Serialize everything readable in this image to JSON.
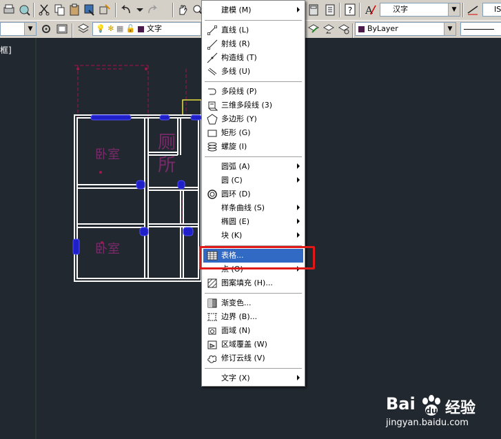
{
  "toolbar_top": {
    "text_style_value": "汉字",
    "style_partial": "IS"
  },
  "toolbar_layer": {
    "layer_name": "文字",
    "color_value": "ByLayer"
  },
  "viewport": {
    "label": "框]"
  },
  "drawing": {
    "rooms": [
      "卧室",
      "厕所",
      "卧室"
    ]
  },
  "context_menu": {
    "header": {
      "label": "建模 (M)",
      "submenu": true
    },
    "groups": [
      [
        {
          "label": "直线 (L)",
          "icon": "line-icon"
        },
        {
          "label": "射线 (R)",
          "icon": "ray-icon"
        },
        {
          "label": "构造线 (T)",
          "icon": "xline-icon"
        },
        {
          "label": "多线 (U)",
          "icon": "multiline-icon"
        }
      ],
      [
        {
          "label": "多段线 (P)",
          "icon": "polyline-icon"
        },
        {
          "label": "三维多段线 (3)",
          "icon": "3d-polyline-icon"
        },
        {
          "label": "多边形 (Y)",
          "icon": "polygon-icon"
        },
        {
          "label": "矩形 (G)",
          "icon": "rectangle-icon"
        },
        {
          "label": "螺旋 (I)",
          "icon": "helix-icon"
        }
      ],
      [
        {
          "label": "圆弧 (A)",
          "submenu": true
        },
        {
          "label": "圆 (C)",
          "submenu": true
        },
        {
          "label": "圆环 (D)",
          "icon": "donut-icon"
        },
        {
          "label": "样条曲线 (S)",
          "submenu": true
        },
        {
          "label": "椭圆 (E)",
          "submenu": true
        },
        {
          "label": "块 (K)",
          "submenu": true
        }
      ],
      [
        {
          "label": "表格...",
          "icon": "table-icon",
          "highlighted": true
        },
        {
          "label": "点 (O)",
          "submenu": true
        },
        {
          "label": "图案填充 (H)...",
          "icon": "hatch-icon"
        }
      ],
      [
        {
          "label": "渐变色...",
          "icon": "gradient-icon"
        },
        {
          "label": "边界 (B)...",
          "icon": "boundary-icon"
        },
        {
          "label": "面域 (N)",
          "icon": "region-icon"
        },
        {
          "label": "区域覆盖 (W)",
          "icon": "wipeout-icon"
        },
        {
          "label": "修订云线 (V)",
          "icon": "revcloud-icon"
        }
      ],
      [
        {
          "label": "文字 (X)",
          "submenu": true
        }
      ]
    ]
  },
  "watermark": {
    "brand_left": "Bai",
    "brand_right": "经验",
    "url": "jingyan.baidu.com"
  },
  "colors": {
    "menu_highlight": "#316ac5",
    "annotation_red": "#e01818",
    "canvas_bg": "#212830",
    "toolbar_bg": "#d4d0c8"
  }
}
